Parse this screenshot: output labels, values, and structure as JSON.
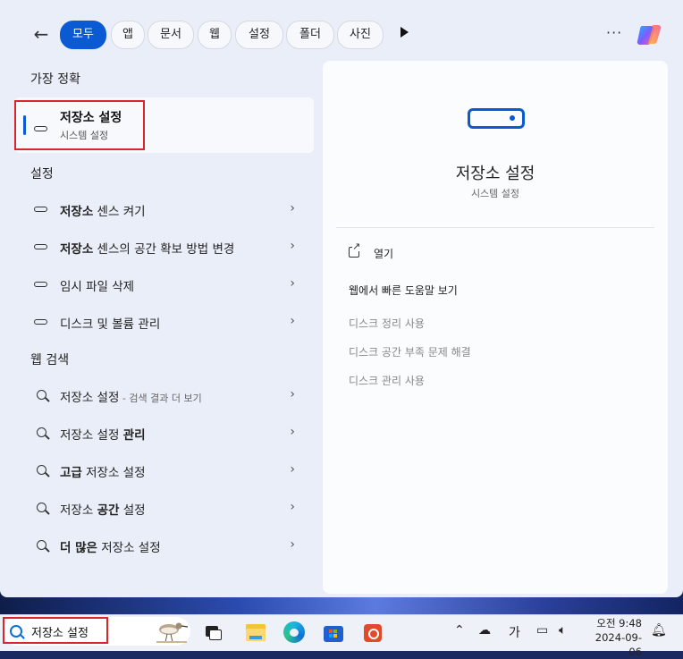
{
  "filters": {
    "tabs": [
      "모두",
      "앱",
      "문서",
      "웹",
      "설정",
      "폴더",
      "사진"
    ],
    "active": "모두"
  },
  "left": {
    "best_match_header": "가장 정확",
    "best_match": {
      "title": "저장소 설정",
      "subtitle": "시스템 설정"
    },
    "settings_header": "설정",
    "settings_items": [
      {
        "bold": "저장소",
        "rest": " 센스 켜기"
      },
      {
        "bold": "저장소",
        "rest": " 센스의 공간 확보 방법 변경"
      },
      {
        "bold": "",
        "rest": "임시 파일 삭제"
      },
      {
        "bold": "",
        "rest": "디스크 및 볼륨 관리"
      }
    ],
    "web_header": "웹 검색",
    "web_items": [
      {
        "pre": "저장소 설정",
        "bold": "",
        "suffix": " - 검색 결과 더 보기"
      },
      {
        "pre": "저장소 설정 ",
        "bold": "관리",
        "suffix": ""
      },
      {
        "pre": "",
        "bold": "고급",
        "post": " 저장소 설정",
        "suffix": ""
      },
      {
        "pre": "저장소 ",
        "bold": "공간",
        "post": " 설정",
        "suffix": ""
      },
      {
        "pre": "",
        "bold": "더 많은",
        "post": " 저장소 설정",
        "suffix": ""
      }
    ]
  },
  "right": {
    "title": "저장소 설정",
    "subtitle": "시스템 설정",
    "open_label": "열기",
    "web_help": "웹에서 빠른 도움말 보기",
    "links": [
      "디스크 정리 사용",
      "디스크 공간 부족 문제 해결",
      "디스크 관리 사용"
    ]
  },
  "taskbar": {
    "search_text": "저장소 설정",
    "ime": "가",
    "time": "오전 9:48",
    "date": "2024-09-06"
  },
  "icons": {
    "back": "back-arrow-icon",
    "play": "play-icon",
    "more": "more-icon",
    "copilot": "copilot-icon"
  },
  "colors": {
    "accent": "#0a5bd3",
    "highlight_box": "#d9262c"
  }
}
